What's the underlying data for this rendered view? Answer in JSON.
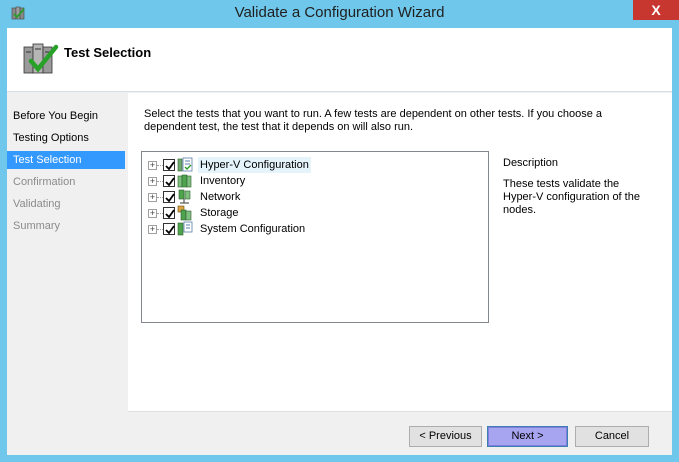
{
  "window": {
    "title": "Validate a Configuration Wizard",
    "close_glyph": "X"
  },
  "header": {
    "title": "Test Selection"
  },
  "nav": {
    "items": [
      {
        "label": "Before You Begin",
        "state": "normal"
      },
      {
        "label": "Testing Options",
        "state": "normal"
      },
      {
        "label": "Test Selection",
        "state": "selected"
      },
      {
        "label": "Confirmation",
        "state": "disabled"
      },
      {
        "label": "Validating",
        "state": "disabled"
      },
      {
        "label": "Summary",
        "state": "disabled"
      }
    ]
  },
  "content": {
    "instructions": "Select the tests that you want to run.  A few tests are dependent on other tests.  If you choose a dependent test, the test that it depends on will also run.",
    "tree": [
      {
        "label": "Hyper-V Configuration",
        "checked": true,
        "expander": "+",
        "icon": "hyperv-config-icon"
      },
      {
        "label": "Inventory",
        "checked": true,
        "expander": "+",
        "icon": "inventory-icon"
      },
      {
        "label": "Network",
        "checked": true,
        "expander": "+",
        "icon": "network-icon"
      },
      {
        "label": "Storage",
        "checked": true,
        "expander": "+",
        "icon": "storage-icon"
      },
      {
        "label": "System Configuration",
        "checked": true,
        "expander": "+",
        "icon": "system-config-icon"
      }
    ],
    "description_title": "Description",
    "description_text": "These tests validate the Hyper-V configuration of the nodes."
  },
  "buttons": {
    "previous": "< Previous",
    "next": "Next >",
    "cancel": "Cancel"
  },
  "colors": {
    "frame": "#6fc7eb",
    "selected_nav": "#3399ff",
    "close": "#c7372f",
    "default_button": "#a7a4f0"
  }
}
